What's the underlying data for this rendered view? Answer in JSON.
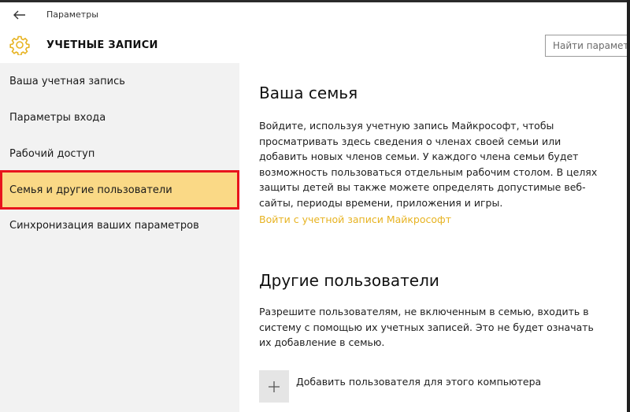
{
  "window": {
    "title": "Параметры",
    "back_icon": "arrow-left-icon"
  },
  "header": {
    "icon": "gear-icon",
    "title": "УЧЕТНЫЕ ЗАПИСИ",
    "search_placeholder": "Найти параметр"
  },
  "sidebar": {
    "items": [
      {
        "label": "Ваша учетная запись",
        "selected": false
      },
      {
        "label": "Параметры входа",
        "selected": false
      },
      {
        "label": "Рабочий доступ",
        "selected": false
      },
      {
        "label": "Семья и другие пользователи",
        "selected": true
      },
      {
        "label": "Синхронизация ваших параметров",
        "selected": false
      }
    ]
  },
  "family": {
    "heading": "Ваша семья",
    "description_lines": [
      "Войдите, используя учетную запись Майкрософт, чтобы",
      "просматривать здесь сведения о членах своей семьи или",
      "добавить новых членов семьи. У каждого члена семьи будет",
      "возможность пользоваться отдельным рабочим столом. В целях",
      "защиты детей вы также можете определять допустимые веб-",
      "сайты, периоды времени, приложения и игры."
    ],
    "link": "Войти с учетной записи Майкрософт"
  },
  "others": {
    "heading": "Другие пользователи",
    "description_lines": [
      "Разрешите пользователям, не включенным в семью, входить в",
      "систему с помощью их учетных записей. Это не будет означать",
      "их добавление в семью."
    ],
    "add_icon": "plus-icon",
    "add_label": "Добавить пользователя для этого компьютера"
  },
  "colors": {
    "accent": "#e7b322",
    "selected_bg": "#fad986",
    "highlight_border": "#e8141c",
    "sidebar_bg": "#f2f2f2"
  }
}
